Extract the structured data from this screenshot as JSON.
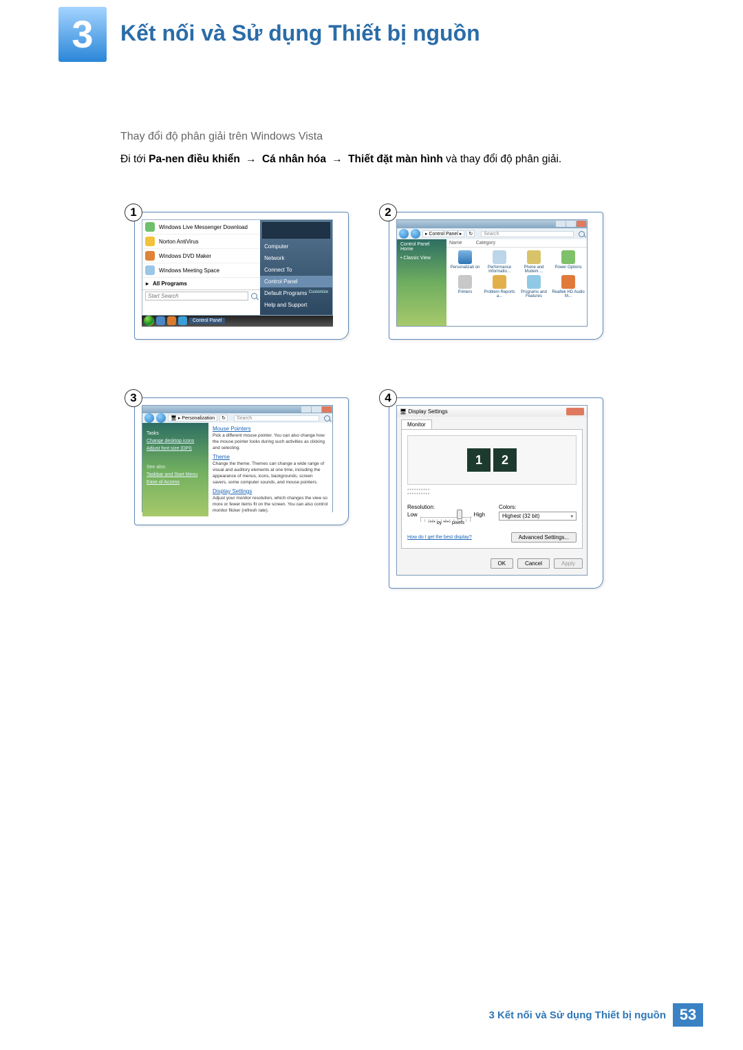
{
  "chapter": {
    "number": "3",
    "title": "Kết nối và Sử dụng Thiết bị nguồn"
  },
  "subheading": "Thay đổi độ phân giải trên Windows Vista",
  "instruction": {
    "pre": "Đi tới ",
    "b1": "Pa-nen điều khiển",
    "arrow": " → ",
    "b2": "Cá nhân hóa",
    "b3": "Thiết đặt màn hình",
    "post": " và thay đổi độ phân giải."
  },
  "steps": {
    "s1": "1",
    "s2": "2",
    "s3": "3",
    "s4": "4"
  },
  "panel1": {
    "start": {
      "items": [
        "Windows Live Messenger Download",
        "Norton AntiVirus",
        "Windows DVD Maker",
        "Windows Meeting Space"
      ],
      "all_programs": "All Programs",
      "search_ph": "Start Search"
    },
    "right": {
      "computer": "Computer",
      "network": "Network",
      "connect": "Connect To",
      "control_panel": "Control Panel",
      "default_programs": "Default Programs",
      "customize": "Customize",
      "help": "Help and Support"
    },
    "taskbar_label": "Control Panel"
  },
  "panel2": {
    "crumb": "Control Panel",
    "search_ph": "Search",
    "cols": {
      "name": "Name",
      "category": "Category"
    },
    "side": {
      "home": "Control Panel Home",
      "classic": "Classic View"
    },
    "icons": [
      "Personalizati\non",
      "Performance Informatio...",
      "Phone and Modem ...",
      "Power Options",
      "Printers",
      "Problem Reports a...",
      "Programs and Features",
      "Realtek HD Audio M..."
    ]
  },
  "panel3": {
    "crumb": "Personalization",
    "search_ph": "Search",
    "side": {
      "tasks": "Tasks",
      "lk1": "Change desktop icons",
      "lk2": "Adjust font size (DPI)",
      "see": "See also",
      "lk3": "Taskbar and Start Menu",
      "lk4": "Ease of Access"
    },
    "main": {
      "mouse_h": "Mouse Pointers",
      "mouse_p": "Pick a different mouse pointer. You can also change how the mouse pointer looks during such activities as clicking and selecting.",
      "theme_h": "Theme",
      "theme_p": "Change the theme. Themes can change a wide range of visual and auditory elements at one time, including the appearance of menus, icons, backgrounds, screen savers, some computer sounds, and mouse pointers.",
      "disp_h": "Display Settings",
      "disp_p": "Adjust your monitor resolution, which changes the view so more or fewer items fit on the screen. You can also control monitor flicker (refresh rate)."
    }
  },
  "panel4": {
    "title": "Display Settings",
    "tab": "Monitor",
    "mon1": "1",
    "mon2": "2",
    "stars1": "**********",
    "stars2": "**********",
    "res_label": "Resolution:",
    "low": "Low",
    "high": "High",
    "px": "**** by **** pixels",
    "col_label": "Colors:",
    "col_val": "Highest (32 bit)",
    "help_link": "How do I get the best display?",
    "adv": "Advanced Settings...",
    "ok": "OK",
    "cancel": "Cancel",
    "apply": "Apply"
  },
  "footer": {
    "text": "3 Kết nối và Sử dụng Thiết bị nguồn",
    "page": "53"
  }
}
